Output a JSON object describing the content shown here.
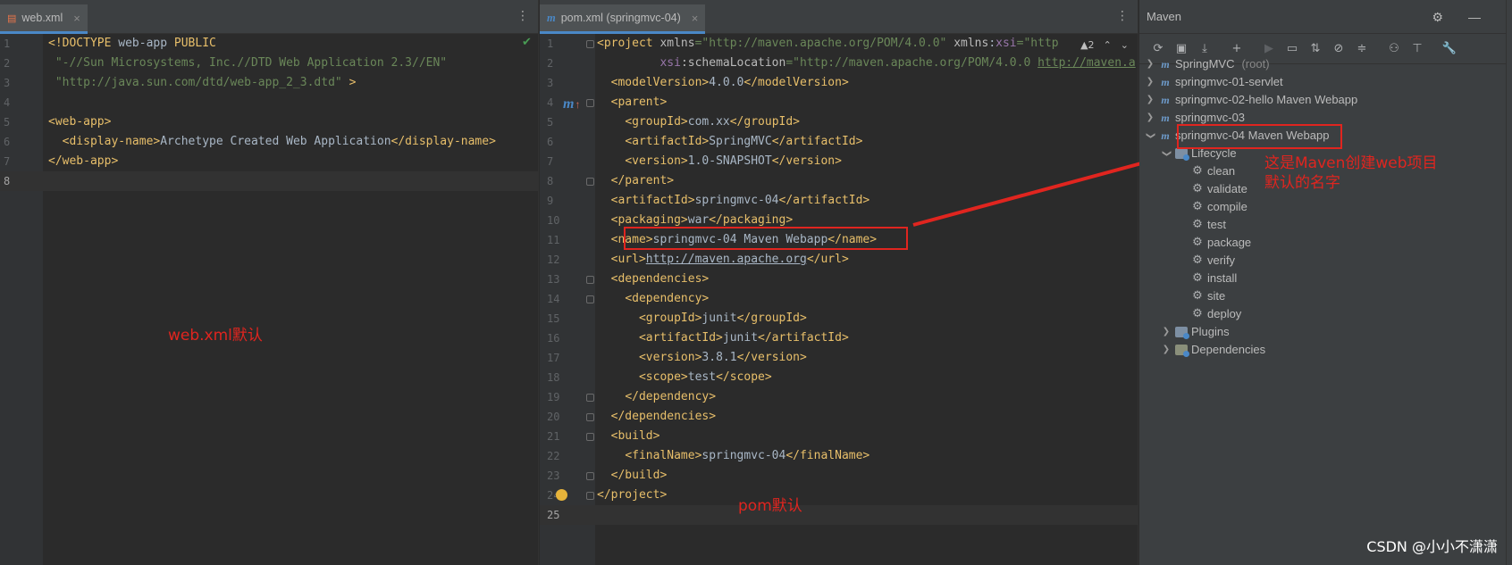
{
  "left_editor": {
    "tab_label": "web.xml",
    "tab_close": "×",
    "menu_glyph": "⋮",
    "check_glyph": "✔",
    "annotation": "web.xml默认"
  },
  "mid_editor": {
    "tab_label": "pom.xml (springmvc-04)",
    "tab_close": "×",
    "menu_glyph": "⋮",
    "warning_count": "▲2",
    "nav_up": "⌃",
    "nav_down": "⌄",
    "annotation": "pom默认"
  },
  "maven": {
    "title": "Maven",
    "head_tools": "⚙ —",
    "toolbar_icons": [
      "reload-icon",
      "add-project-icon",
      "download-icon",
      "plus-icon",
      "run-icon",
      "execute-icon",
      "toggle-offline-icon",
      "skip-tests-icon",
      "collapse-icon",
      "show-deps-icon",
      "expand-icon",
      "settings-wrench-icon"
    ],
    "toolbar_glyphs": [
      "⟳",
      "▣",
      "⤓",
      "+",
      "▶",
      "▭",
      "⇅",
      "⊘",
      "≑",
      "⚇",
      "⊤",
      "🔧"
    ],
    "tree": [
      {
        "label": "SpringMVC",
        "suffix": "(root)"
      },
      {
        "label": "springmvc-01-servlet",
        "suffix": ""
      },
      {
        "label": "springmvc-02-hello Maven Webapp",
        "suffix": ""
      },
      {
        "label": "springmvc-03",
        "suffix": ""
      },
      {
        "label": "springmvc-04 Maven Webapp",
        "suffix": ""
      }
    ],
    "lifecycle_label": "Lifecycle",
    "lifecycle": [
      "clean",
      "validate",
      "compile",
      "test",
      "package",
      "verify",
      "install",
      "site",
      "deploy"
    ],
    "plugins_label": "Plugins",
    "dependencies_label": "Dependencies",
    "annotation_line1": "这是Maven创建web项目",
    "annotation_line2": "默认的名字"
  },
  "watermark": "CSDN @小小不潇潇",
  "colors": {
    "editor_bg": "#2b2b2b",
    "panel_bg": "#3c3f41",
    "tag": "#e8bf6a",
    "string": "#6a8759",
    "annotation_red": "#e0251f"
  }
}
